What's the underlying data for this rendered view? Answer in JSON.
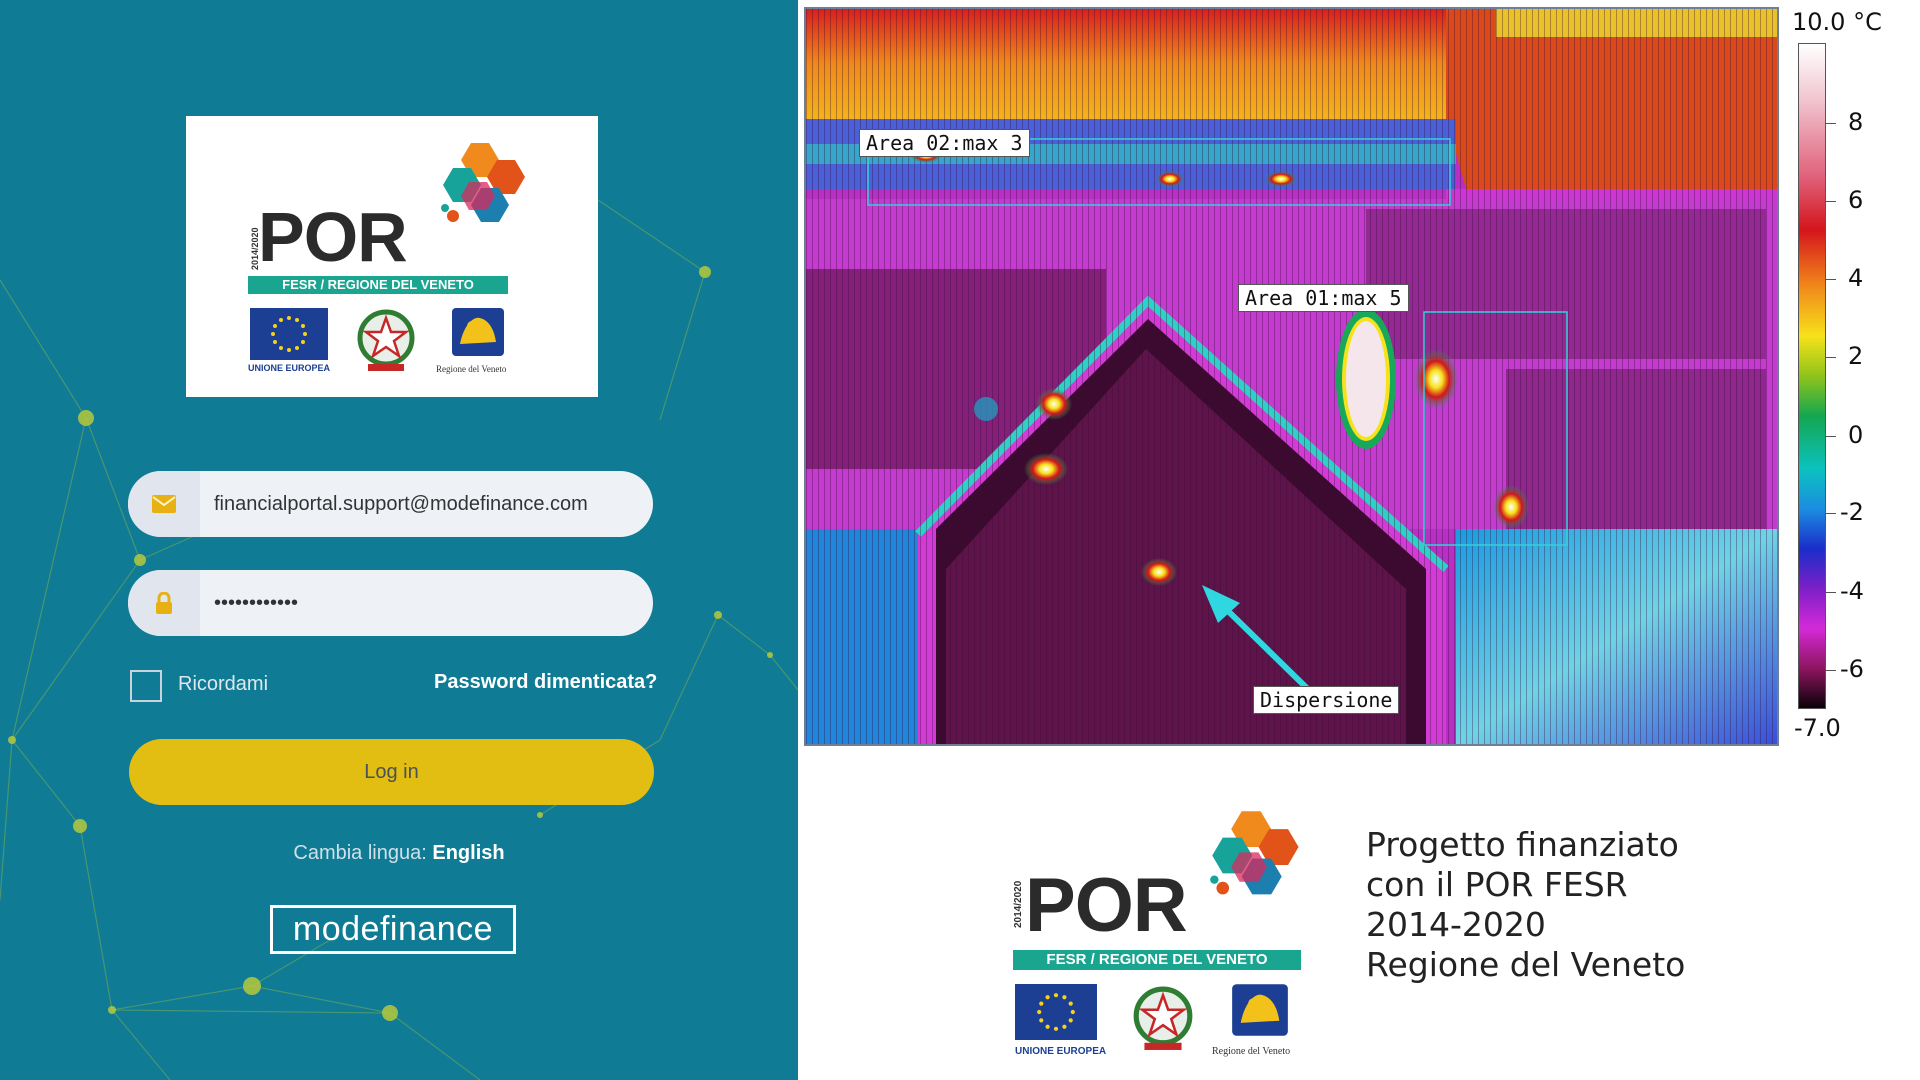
{
  "login": {
    "logo": {
      "years": "2014/2020",
      "word": "POR",
      "ribbon": "FESR / REGIONE DEL VENETO",
      "eu_label": "UNIONE EUROPEA",
      "veneto_label": "Regione del Veneto"
    },
    "email": {
      "value": "financialportal.support@modefinance.com",
      "icon": "envelope-icon"
    },
    "password": {
      "value": "••••••••••••",
      "icon": "lock-icon"
    },
    "remember_label": "Ricordami",
    "forgot_label": "Password dimenticata?",
    "login_label": "Log in",
    "language_prefix": "Cambia lingua:",
    "language_link": "English",
    "brand": "modefinance"
  },
  "thermal": {
    "area_02_label": "Area 02:max 3",
    "area_01_label": "Area 01:max 5",
    "dispersion_label": "Dispersione",
    "scale": {
      "max_label": "10.0 °C",
      "min_label": "-7.0",
      "ticks": [
        "8",
        "6",
        "4",
        "2",
        "0",
        "-2",
        "-4",
        "-6"
      ]
    }
  },
  "funding": {
    "logo": {
      "years": "2014/2020",
      "word": "POR",
      "ribbon": "FESR / REGIONE DEL VENETO",
      "eu_label": "UNIONE EUROPEA",
      "veneto_label": "Regione del Veneto"
    },
    "lines": [
      "Progetto finanziato",
      "con il POR FESR",
      "2014-2020",
      "Regione del Veneto"
    ]
  },
  "colors": {
    "panel_bg": "#0f7b94",
    "login_button": "#e2bd12",
    "ribbon": "#1aa591",
    "eu_blue": "#1c3f94"
  }
}
